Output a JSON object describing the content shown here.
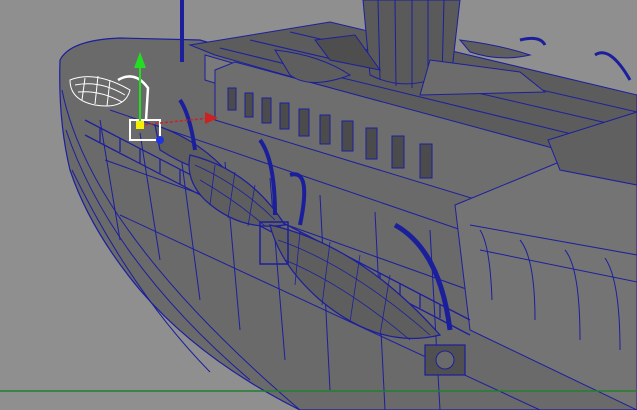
{
  "viewport": {
    "background_color": "#8f8f8f",
    "wire_color": "#1c1f9c",
    "hull_fill": "#6a6a6a",
    "deck_fill": "#5c5c5c",
    "dark_fill": "#4b4b4b",
    "light_fill": "#7c7c7c",
    "selection_color": "#ffffff",
    "grid_line_color": "#1f7f2f",
    "manipulator": {
      "y_axis_color": "#22dd22",
      "x_axis_color": "#cc2222",
      "z_axis_color": "#2233dd"
    }
  }
}
